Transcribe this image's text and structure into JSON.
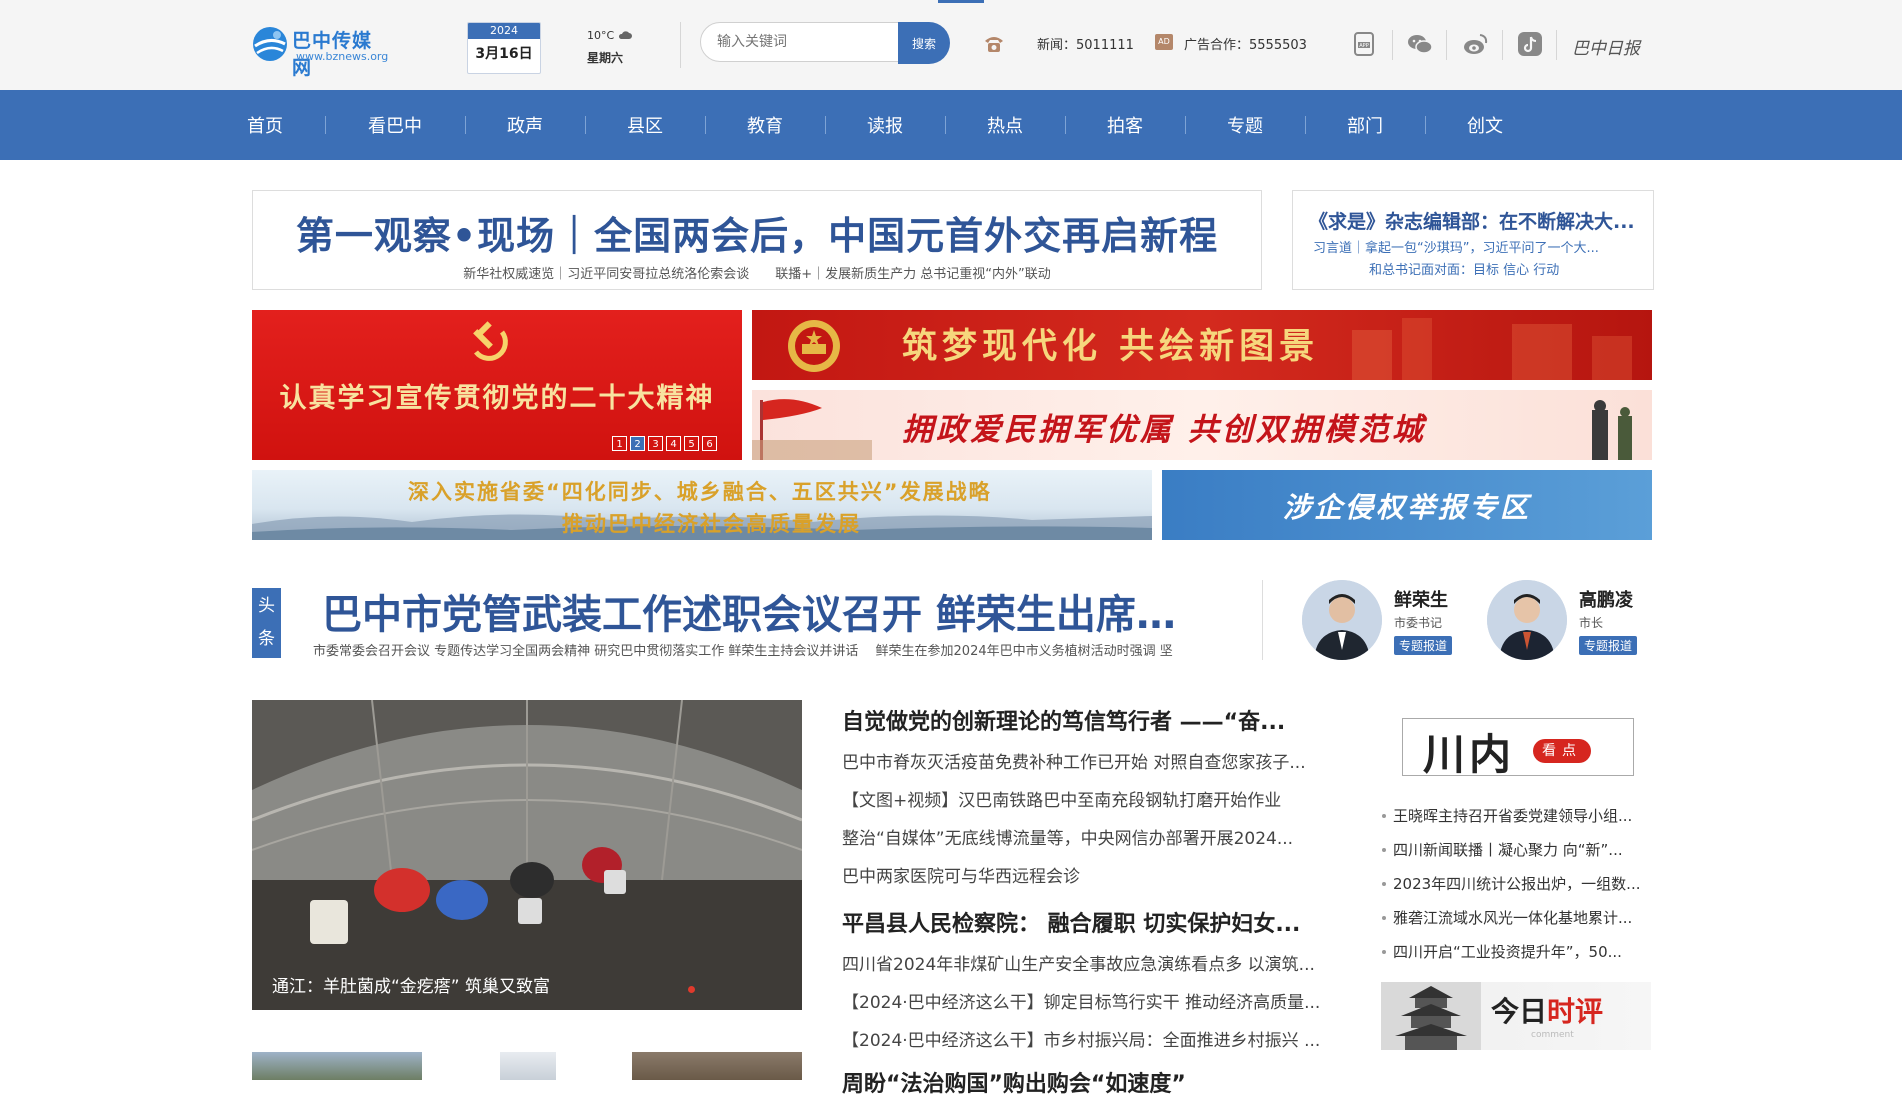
{
  "top": {
    "logo_name": "巴中传媒网",
    "logo_domain": "www.bznews.org",
    "date_year": "2024",
    "date_md": "3月16日",
    "weather_temp": "10°C",
    "weekday": "星期六",
    "search_placeholder": "输入关键词",
    "search_button": "搜索",
    "hotline_news": "新闻：5011111",
    "ad_icon": "AD",
    "hotline_ad": "广告合作：5555503",
    "brand_script": "巴中日报"
  },
  "nav": [
    "首页",
    "看巴中",
    "政声",
    "县区",
    "教育",
    "读报",
    "热点",
    "拍客",
    "专题",
    "部门",
    "创文"
  ],
  "headline": {
    "title": "第一观察•现场｜全国两会后，中国元首外交再启新程",
    "subs": "新华社权威速览｜习近平同安哥拉总统洛伦索会谈　　联播+｜发展新质生产力 总书记重视“内外”联动"
  },
  "side_headline": {
    "title": "《求是》杂志编辑部：在不断解决大...",
    "sub1": "习言道｜拿起一包“沙琪玛”，习近平问了一个大...",
    "sub2": "和总书记面对面：目标 信心 行动"
  },
  "banners": {
    "red": "认真学习宣传贯彻党的二十大精神",
    "pager": [
      "1",
      "2",
      "3",
      "4",
      "5",
      "6"
    ],
    "pager_active": 2,
    "dream": "筑梦现代化  共绘新图景",
    "army": "拥政爱民拥军优属 共创双拥模范城",
    "city_line1": "深入实施省委“四化同步、城乡融合、五区共兴”发展战略",
    "city_line2": "推动巴中经济社会高质量发展",
    "report": "涉企侵权举报专区"
  },
  "lead": {
    "tag": "头条",
    "title": "巴中市党管武装工作述职会议召开 鲜荣生出席并讲...",
    "subs": "市委常委会召开会议 专题传达学习全国两会精神 研究巴中贯彻落实工作 鲜荣生主持会议并讲话　 鲜荣生在参加2024年巴中市义务植树活动时强调 坚"
  },
  "leaders": [
    {
      "name": "鲜荣生",
      "role": "市委书记",
      "tag": "专题报道"
    },
    {
      "name": "高鹏凌",
      "role": "市长",
      "tag": "专题报道"
    }
  ],
  "feature": {
    "caption": "通江：羊肚菌成“金疙瘩” 筑巢又致富"
  },
  "news": [
    {
      "text": "自觉做党的创新理论的笃信笃行者 ——“奋...",
      "big": true
    },
    {
      "text": "巴中市脊灰灭活疫苗免费补种工作已开始 对照自查您家孩子...",
      "big": false
    },
    {
      "text": "【文图+视频】汉巴南铁路巴中至南充段钢轨打磨开始作业",
      "big": false
    },
    {
      "text": "整治“自媒体”无底线博流量等，中央网信办部署开展2024...",
      "big": false
    },
    {
      "text": "巴中两家医院可与华西远程会诊",
      "big": false
    },
    {
      "text": "平昌县人民检察院： 融合履职 切实保护妇女...",
      "big": true
    },
    {
      "text": "四川省2024年非煤矿山生产安全事故应急演练看点多 以演筑...",
      "big": false
    },
    {
      "text": "【2024·巴中经济这么干】铆定目标笃行实干 推动经济高质量...",
      "big": false
    },
    {
      "text": "【2024·巴中经济这么干】市乡村振兴局：全面推进乡村振兴 ...",
      "big": false
    },
    {
      "text": "周盼“法治购国”购出购会“如速度”",
      "big": true
    }
  ],
  "right": {
    "box_big": "川内",
    "box_badge": "看点",
    "items": [
      "王晓晖主持召开省委党建领导小组...",
      "四川新闻联播丨凝心聚力 向“新”...",
      "2023年四川统计公报出炉，一组数...",
      "雅砻江流域水风光一体化基地累计...",
      "四川开启“工业投资提升年”，50..."
    ],
    "today_a": "今日",
    "today_b": "时评",
    "today_en": "comment"
  },
  "colors": {
    "brand_blue": "#3c6fb6",
    "headline_blue": "#2f5597",
    "red": "#d6261f"
  }
}
